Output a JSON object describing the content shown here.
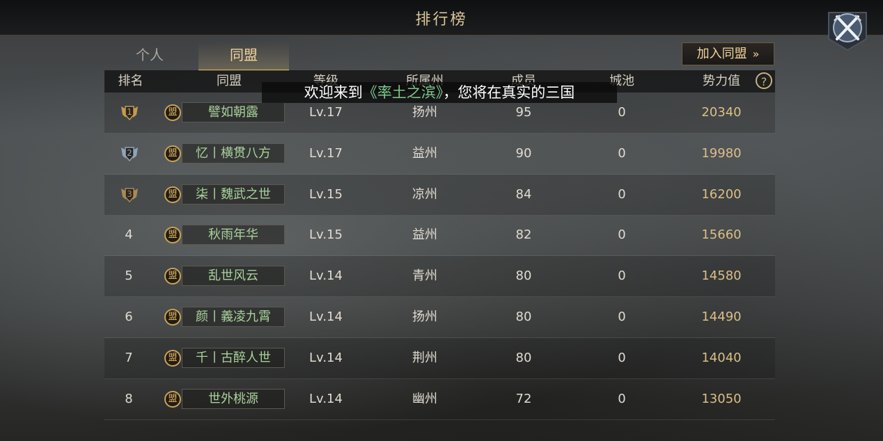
{
  "title": "排行榜",
  "tabs": [
    {
      "label": "个人",
      "active": false
    },
    {
      "label": "同盟",
      "active": true
    }
  ],
  "join_button": {
    "label": "加入同盟",
    "arrow": "»"
  },
  "columns": {
    "rank": "排名",
    "alliance": "同盟",
    "level": "等级",
    "province": "所属州",
    "members": "成员",
    "cities": "城池",
    "power": "势力值",
    "help": "?"
  },
  "subtitle": {
    "before": "欢迎来到",
    "game": "《率土之滨》",
    "after": "，您将在真实的三国"
  },
  "emblem_glyph": "盟",
  "rows": [
    {
      "rank": "1",
      "name": "譬如朝露",
      "level": "Lv.17",
      "province": "扬州",
      "members": "95",
      "cities": "0",
      "power": "20340",
      "medal": "gold"
    },
    {
      "rank": "2",
      "name": "忆丨横贯八方",
      "level": "Lv.17",
      "province": "益州",
      "members": "90",
      "cities": "0",
      "power": "19980",
      "medal": "silver"
    },
    {
      "rank": "3",
      "name": "柒丨魏武之世",
      "level": "Lv.15",
      "province": "凉州",
      "members": "84",
      "cities": "0",
      "power": "16200",
      "medal": "bronze"
    },
    {
      "rank": "4",
      "name": "秋雨年华",
      "level": "Lv.15",
      "province": "益州",
      "members": "82",
      "cities": "0",
      "power": "15660"
    },
    {
      "rank": "5",
      "name": "乱世风云",
      "level": "Lv.14",
      "province": "青州",
      "members": "80",
      "cities": "0",
      "power": "14580"
    },
    {
      "rank": "6",
      "name": "颜丨義凌九霄",
      "level": "Lv.14",
      "province": "扬州",
      "members": "80",
      "cities": "0",
      "power": "14490"
    },
    {
      "rank": "7",
      "name": "千丨古醉人世",
      "level": "Lv.14",
      "province": "荆州",
      "members": "80",
      "cities": "0",
      "power": "14040"
    },
    {
      "rank": "8",
      "name": "世外桃源",
      "level": "Lv.14",
      "province": "幽州",
      "members": "72",
      "cities": "0",
      "power": "13050"
    }
  ],
  "colors": {
    "gold": "#c49a52",
    "silver": "#8fa4b8",
    "bronze": "#a88a5a",
    "accent": "#f0d49a",
    "alliance_name": "#a8d29a"
  }
}
